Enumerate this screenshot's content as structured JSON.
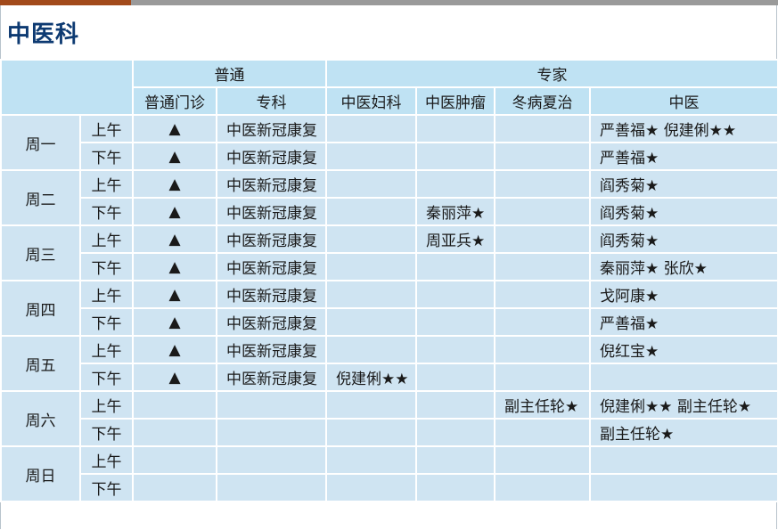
{
  "page_title": "中医科",
  "colors": {
    "header_bg": "#bfe2f3",
    "cell_bg": "#cfe4f2",
    "title": "#0d3a72",
    "accent_bar": "#a24a1b"
  },
  "header": {
    "group_general": "普通",
    "group_expert": "专家",
    "columns": [
      "普通门诊",
      "专科",
      "中医妇科",
      "中医肿瘤",
      "冬病夏治",
      "中医"
    ]
  },
  "days": [
    {
      "day": "周一",
      "rows": [
        {
          "period": "上午",
          "general": "▲",
          "specialty": "中医新冠康复",
          "gyn": "",
          "tumor": "",
          "winter": "",
          "tcm": "严善福★  倪建俐★★"
        },
        {
          "period": "下午",
          "general": "▲",
          "specialty": "中医新冠康复",
          "gyn": "",
          "tumor": "",
          "winter": "",
          "tcm": "严善福★"
        }
      ]
    },
    {
      "day": "周二",
      "rows": [
        {
          "period": "上午",
          "general": "▲",
          "specialty": "中医新冠康复",
          "gyn": "",
          "tumor": "",
          "winter": "",
          "tcm": "阎秀菊★"
        },
        {
          "period": "下午",
          "general": "▲",
          "specialty": "中医新冠康复",
          "gyn": "",
          "tumor": "秦丽萍★",
          "winter": "",
          "tcm": "阎秀菊★"
        }
      ]
    },
    {
      "day": "周三",
      "rows": [
        {
          "period": "上午",
          "general": "▲",
          "specialty": "中医新冠康复",
          "gyn": "",
          "tumor": "周亚兵★",
          "winter": "",
          "tcm": "阎秀菊★"
        },
        {
          "period": "下午",
          "general": "▲",
          "specialty": "中医新冠康复",
          "gyn": "",
          "tumor": "",
          "winter": "",
          "tcm": "秦丽萍★  张欣★"
        }
      ]
    },
    {
      "day": "周四",
      "rows": [
        {
          "period": "上午",
          "general": "▲",
          "specialty": "中医新冠康复",
          "gyn": "",
          "tumor": "",
          "winter": "",
          "tcm": "戈阿康★"
        },
        {
          "period": "下午",
          "general": "▲",
          "specialty": "中医新冠康复",
          "gyn": "",
          "tumor": "",
          "winter": "",
          "tcm": "严善福★"
        }
      ]
    },
    {
      "day": "周五",
      "rows": [
        {
          "period": "上午",
          "general": "▲",
          "specialty": "中医新冠康复",
          "gyn": "",
          "tumor": "",
          "winter": "",
          "tcm": "倪红宝★"
        },
        {
          "period": "下午",
          "general": "▲",
          "specialty": "中医新冠康复",
          "gyn": "倪建俐★★",
          "tumor": "",
          "winter": "",
          "tcm": ""
        }
      ]
    },
    {
      "day": "周六",
      "rows": [
        {
          "period": "上午",
          "general": "",
          "specialty": "",
          "gyn": "",
          "tumor": "",
          "winter": "副主任轮★",
          "tcm": "倪建俐★★  副主任轮★"
        },
        {
          "period": "下午",
          "general": "",
          "specialty": "",
          "gyn": "",
          "tumor": "",
          "winter": "",
          "tcm": "副主任轮★"
        }
      ]
    },
    {
      "day": "周日",
      "rows": [
        {
          "period": "上午",
          "general": "",
          "specialty": "",
          "gyn": "",
          "tumor": "",
          "winter": "",
          "tcm": ""
        },
        {
          "period": "下午",
          "general": "",
          "specialty": "",
          "gyn": "",
          "tumor": "",
          "winter": "",
          "tcm": ""
        }
      ]
    }
  ]
}
